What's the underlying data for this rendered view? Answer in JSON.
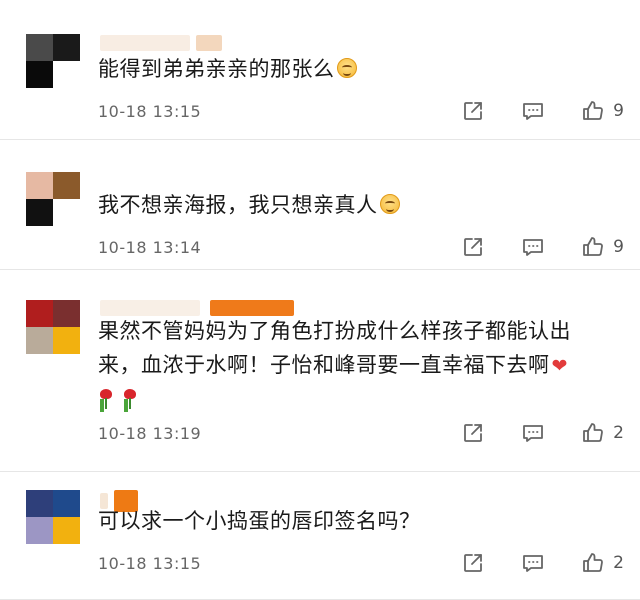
{
  "comments": [
    {
      "avatar_colors": [
        "#4a4a4a",
        "#1a1a1a",
        "#0a0a0a",
        "#ffffff"
      ],
      "username_blur_colors": [
        "#f6e8d8",
        "#f3d9c2"
      ],
      "text": "能得到弟弟亲亲的那张么",
      "emoji": "smiling-face-emoji",
      "timestamp": "10-18 13:15",
      "like_count": "9"
    },
    {
      "avatar_colors": [
        "#e6b9a3",
        "#8b5a2b",
        "#111111",
        "#ffffff"
      ],
      "username_blur_colors": [],
      "text": "我不想亲海报，我只想亲真人",
      "emoji": "smiling-face-emoji",
      "timestamp": "10-18 13:14",
      "like_count": "9"
    },
    {
      "avatar_colors": [
        "#b01e1e",
        "#7a2f2f",
        "#b9ab9a",
        "#f2b10f"
      ],
      "username_blur_colors": [
        "#f7ece0",
        "#ef7a1a"
      ],
      "text_line1": "果然不管妈妈为了角色打扮成什么样孩子都能认出",
      "text_line2": "来，血浓于水啊！子怡和峰哥要一直幸福下去啊",
      "emoji": "red-heart-emoji",
      "extra_emojis": [
        "rose-emoji",
        "rose-emoji"
      ],
      "timestamp": "10-18 13:19",
      "like_count": "2"
    },
    {
      "avatar_colors": [
        "#2e3f7a",
        "#1f4a8c",
        "#9c96c4",
        "#f2b10f"
      ],
      "username_blur_colors": [
        "#ee7a14"
      ],
      "text": "可以求一个小捣蛋的唇印签名吗？",
      "timestamp": "10-18 13:15",
      "like_count": "2"
    }
  ],
  "icons": {
    "share": "share-icon",
    "reply": "comment-icon",
    "like": "thumbs-up-icon"
  },
  "colors": {
    "text": "#1a1a1a",
    "meta": "#666666",
    "icon": "#666666",
    "divider": "#e6e6e6"
  }
}
